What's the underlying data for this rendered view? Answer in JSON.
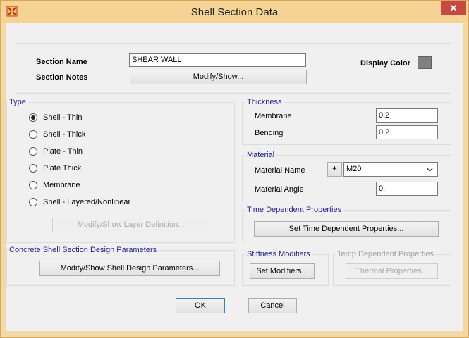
{
  "window": {
    "title": "Shell Section Data",
    "close_glyph": "✕"
  },
  "section": {
    "name_label": "Section Name",
    "name_value": "SHEAR WALL",
    "notes_label": "Section Notes",
    "notes_button": "Modify/Show...",
    "display_color_label": "Display Color",
    "display_color": "#808080"
  },
  "type": {
    "legend": "Type",
    "options": [
      "Shell - Thin",
      "Shell - Thick",
      "Plate - Thin",
      "Plate Thick",
      "Membrane",
      "Shell - Layered/Nonlinear"
    ],
    "selected": "Shell - Thin",
    "layer_button": "Modify/Show Layer Definition..."
  },
  "concrete": {
    "legend": "Concrete Shell Section Design Parameters",
    "button": "Modify/Show Shell Design Parameters..."
  },
  "thickness": {
    "legend": "Thickness",
    "membrane_label": "Membrane",
    "membrane_value": "0.2",
    "bending_label": "Bending",
    "bending_value": "0.2"
  },
  "material": {
    "legend": "Material",
    "name_label": "Material Name",
    "add_button": "+",
    "name_value": "M20",
    "angle_label": "Material Angle",
    "angle_value": "0."
  },
  "time": {
    "legend": "Time Dependent Properties",
    "button": "Set Time Dependent Properties..."
  },
  "stiffness": {
    "legend": "Stiffness Modifiers",
    "button": "Set Modifiers..."
  },
  "temp": {
    "legend": "Temp Dependent Properties",
    "button": "Thermal Properties..."
  },
  "footer": {
    "ok": "OK",
    "cancel": "Cancel"
  },
  "colors": {
    "title_bar": "#f4d394",
    "legend_text": "#1f1f8f",
    "close": "#c74a42"
  }
}
